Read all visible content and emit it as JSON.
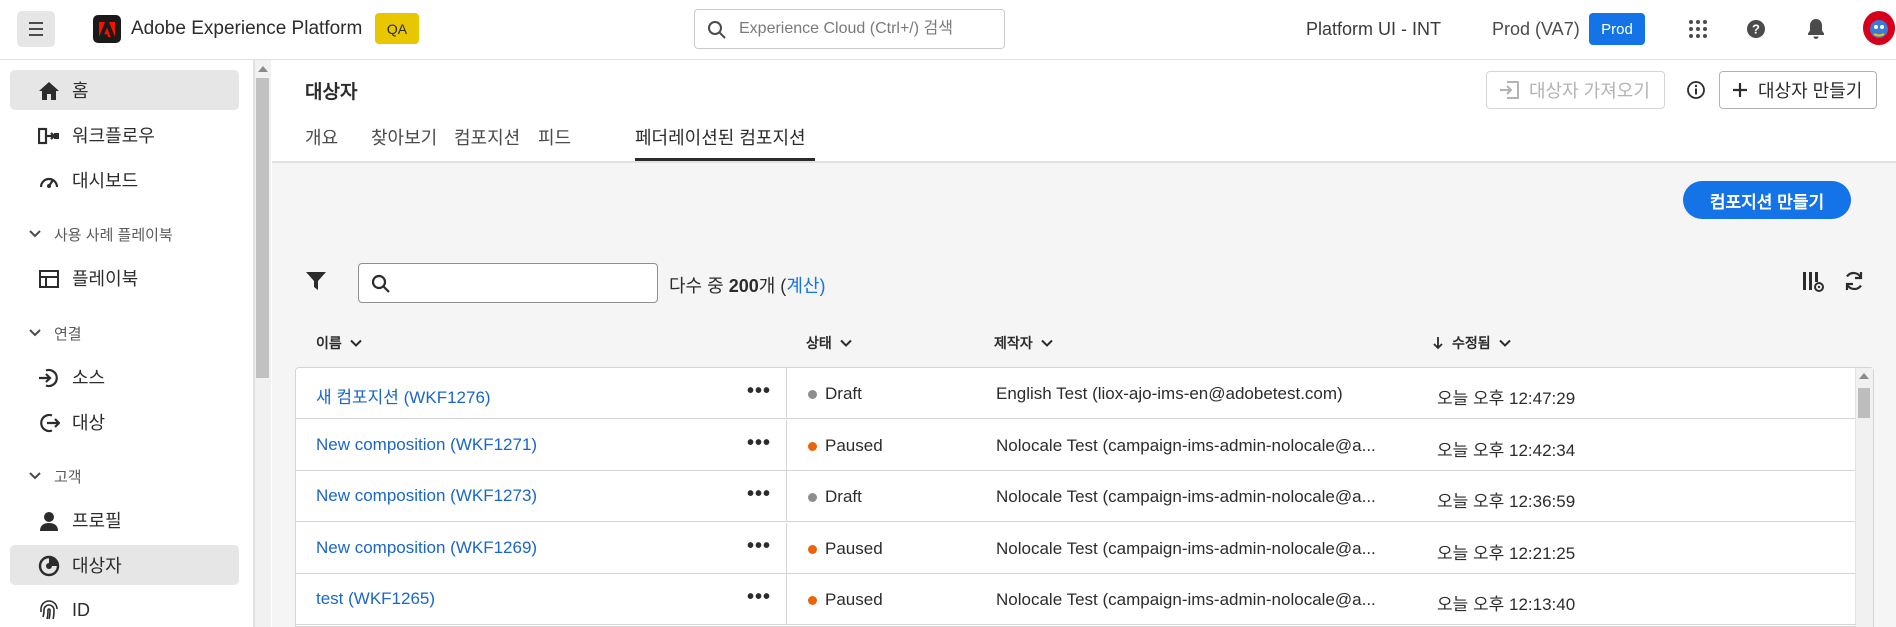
{
  "topbar": {
    "app_title": "Adobe Experience Platform",
    "env_badge": "QA",
    "search_placeholder": "Experience Cloud (Ctrl+/) 검색",
    "org_name": "Platform UI - INT",
    "sandbox_name": "Prod (VA7)",
    "sandbox_badge": "Prod"
  },
  "sidebar": {
    "items": [
      {
        "label": "홈",
        "icon": "home-icon"
      },
      {
        "label": "워크플로우",
        "icon": "workflow-icon"
      },
      {
        "label": "대시보드",
        "icon": "dashboard-icon"
      }
    ],
    "sections": [
      {
        "label": "사용 사례 플레이북",
        "items": [
          {
            "label": "플레이북",
            "icon": "playbook-icon"
          }
        ]
      },
      {
        "label": "연결",
        "items": [
          {
            "label": "소스",
            "icon": "source-icon"
          },
          {
            "label": "대상",
            "icon": "destination-icon"
          }
        ]
      },
      {
        "label": "고객",
        "items": [
          {
            "label": "프로필",
            "icon": "profile-icon"
          },
          {
            "label": "대상자",
            "icon": "audience-icon"
          },
          {
            "label": "ID",
            "icon": "identity-icon"
          }
        ]
      }
    ]
  },
  "page": {
    "title": "대상자",
    "tabs": [
      "개요",
      "찾아보기",
      "컴포지션",
      "피드",
      "페더레이션된 컴포지션"
    ],
    "selected_tab": "페더레이션된 컴포지션",
    "import_button": "대상자 가져오기",
    "create_audience_button": "대상자 만들기",
    "create_composition_button": "컴포지션 만들기"
  },
  "toolbar": {
    "count_prefix": "다수 중",
    "count_number": "200",
    "count_suffix": "개 (",
    "count_link": "계산",
    "count_close": ")"
  },
  "table": {
    "headers": {
      "name": "이름",
      "status": "상태",
      "creator": "제작자",
      "modified": "수정됨"
    },
    "rows": [
      {
        "name": "새 컴포지션 (WKF1276)",
        "status": "Draft",
        "status_color": "#8e8e8e",
        "creator": "English Test (liox-ajo-ims-en@adobetest.com)",
        "modified": "오늘 오후 12:47:29"
      },
      {
        "name": "New composition (WKF1271)",
        "status": "Paused",
        "status_color": "#e8650a",
        "creator": "Nolocale Test (campaign-ims-admin-nolocale@a...",
        "modified": "오늘 오후 12:42:34"
      },
      {
        "name": "New composition (WKF1273)",
        "status": "Draft",
        "status_color": "#8e8e8e",
        "creator": "Nolocale Test (campaign-ims-admin-nolocale@a...",
        "modified": "오늘 오후 12:36:59"
      },
      {
        "name": "New composition (WKF1269)",
        "status": "Paused",
        "status_color": "#e8650a",
        "creator": "Nolocale Test (campaign-ims-admin-nolocale@a...",
        "modified": "오늘 오후 12:21:25"
      },
      {
        "name": "test (WKF1265)",
        "status": "Paused",
        "status_color": "#e8650a",
        "creator": "Nolocale Test (campaign-ims-admin-nolocale@a...",
        "modified": "오늘 오후 12:13:40"
      }
    ]
  },
  "colors": {
    "accent": "#1473e6",
    "link": "#1a66c9",
    "env_badge": "#e8c600"
  }
}
